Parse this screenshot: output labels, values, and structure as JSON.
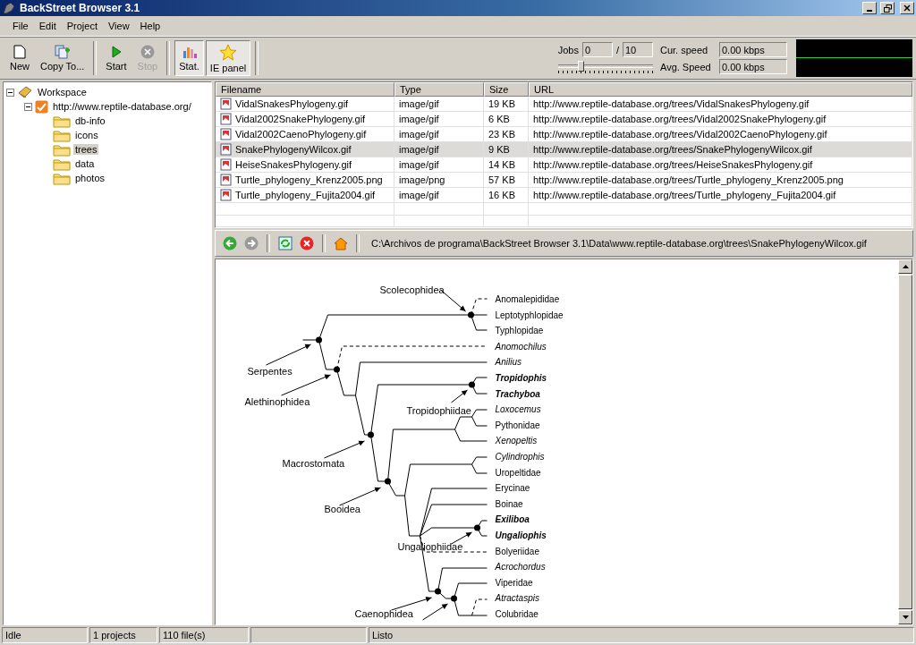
{
  "window": {
    "title": "BackStreet Browser 3.1"
  },
  "menu": [
    "File",
    "Edit",
    "Project",
    "View",
    "Help"
  ],
  "toolbar": {
    "buttons": [
      {
        "label": "New",
        "kind": "new",
        "disabled": false,
        "pressed": false
      },
      {
        "label": "Copy To...",
        "kind": "copy",
        "disabled": false,
        "pressed": false
      },
      {
        "label": "Start",
        "kind": "start",
        "disabled": false,
        "pressed": false
      },
      {
        "label": "Stop",
        "kind": "stop",
        "disabled": true,
        "pressed": false
      },
      {
        "label": "Stat.",
        "kind": "stats",
        "disabled": false,
        "pressed": true
      },
      {
        "label": "IE panel",
        "kind": "star",
        "disabled": false,
        "pressed": true
      }
    ]
  },
  "jobs": {
    "label": "Jobs",
    "current": "0",
    "separator": "/",
    "max": "10",
    "level": 0.22
  },
  "speed": {
    "current_label": "Cur. speed",
    "current_value": "0.00 kbps",
    "average_label": "Avg. Speed",
    "average_value": "0.00 kbps"
  },
  "tree": [
    {
      "label": "Workspace",
      "kind": "workspace",
      "expanded": true,
      "selected": false,
      "children": [
        {
          "label": "http://www.reptile-database.org/",
          "kind": "site",
          "expanded": true,
          "selected": false,
          "children": [
            {
              "label": "db-info",
              "kind": "folder",
              "selected": false
            },
            {
              "label": "icons",
              "kind": "folder",
              "selected": false
            },
            {
              "label": "trees",
              "kind": "folder",
              "selected": true
            },
            {
              "label": "data",
              "kind": "folder",
              "selected": false
            },
            {
              "label": "photos",
              "kind": "folder",
              "selected": false
            }
          ]
        }
      ]
    }
  ],
  "table": {
    "columns": [
      "Filename",
      "Type",
      "Size",
      "URL"
    ],
    "rows": [
      {
        "filename": "VidalSnakesPhylogeny.gif",
        "type": "image/gif",
        "size": "19 KB",
        "url": "http://www.reptile-database.org/trees/VidalSnakesPhylogeny.gif",
        "selected": false
      },
      {
        "filename": "Vidal2002SnakePhylogeny.gif",
        "type": "image/gif",
        "size": "6 KB",
        "url": "http://www.reptile-database.org/trees/Vidal2002SnakePhylogeny.gif",
        "selected": false
      },
      {
        "filename": "Vidal2002CaenoPhylogeny.gif",
        "type": "image/gif",
        "size": "23 KB",
        "url": "http://www.reptile-database.org/trees/Vidal2002CaenoPhylogeny.gif",
        "selected": false
      },
      {
        "filename": "SnakePhylogenyWilcox.gif",
        "type": "image/gif",
        "size": "9 KB",
        "url": "http://www.reptile-database.org/trees/SnakePhylogenyWilcox.gif",
        "selected": true
      },
      {
        "filename": "HeiseSnakesPhylogeny.gif",
        "type": "image/gif",
        "size": "14 KB",
        "url": "http://www.reptile-database.org/trees/HeiseSnakesPhylogeny.gif",
        "selected": false
      },
      {
        "filename": "Turtle_phylogeny_Krenz2005.png",
        "type": "image/png",
        "size": "57 KB",
        "url": "http://www.reptile-database.org/trees/Turtle_phylogeny_Krenz2005.png",
        "selected": false
      },
      {
        "filename": "Turtle_phylogeny_Fujita2004.gif",
        "type": "image/gif",
        "size": "16 KB",
        "url": "http://www.reptile-database.org/trees/Turtle_phylogeny_Fujita2004.gif",
        "selected": false
      }
    ]
  },
  "viewer": {
    "path": "C:\\Archivos de programa\\BackStreet Browser 3.1\\Data\\www.reptile-database.org\\trees\\SnakePhylogenyWilcox.gif",
    "clades": [
      "Scolecophidea",
      "Serpentes",
      "Alethinophidea",
      "Tropidophiidae",
      "Macrostomata",
      "Booidea",
      "Ungaliophiidae",
      "Caenophidea"
    ],
    "taxa": [
      {
        "text": "Anomalepididae",
        "kind": "family"
      },
      {
        "text": "Leptotyphlopidae",
        "kind": "family"
      },
      {
        "text": "Typhlopidae",
        "kind": "family"
      },
      {
        "text": "Anomochilus",
        "kind": "genus"
      },
      {
        "text": "Anilius",
        "kind": "genus"
      },
      {
        "text": "Tropidophis",
        "kind": "key_genus"
      },
      {
        "text": "Trachyboa",
        "kind": "key_genus"
      },
      {
        "text": "Loxocemus",
        "kind": "genus"
      },
      {
        "text": "Pythonidae",
        "kind": "family"
      },
      {
        "text": "Xenopeltis",
        "kind": "genus"
      },
      {
        "text": "Cylindrophis",
        "kind": "genus"
      },
      {
        "text": "Uropeltidae",
        "kind": "family"
      },
      {
        "text": "Erycinae",
        "kind": "family"
      },
      {
        "text": "Boinae",
        "kind": "family"
      },
      {
        "text": "Exiliboa",
        "kind": "key_genus"
      },
      {
        "text": "Ungaliophis",
        "kind": "key_genus"
      },
      {
        "text": "Bolyeriidae",
        "kind": "family"
      },
      {
        "text": "Acrochordus",
        "kind": "genus"
      },
      {
        "text": "Viperidae",
        "kind": "family"
      },
      {
        "text": "Atractaspis",
        "kind": "genus"
      },
      {
        "text": "Colubridae",
        "kind": "family"
      }
    ]
  },
  "status_bar": [
    "Idle",
    "1 projects",
    "110 file(s)",
    "Listo"
  ]
}
